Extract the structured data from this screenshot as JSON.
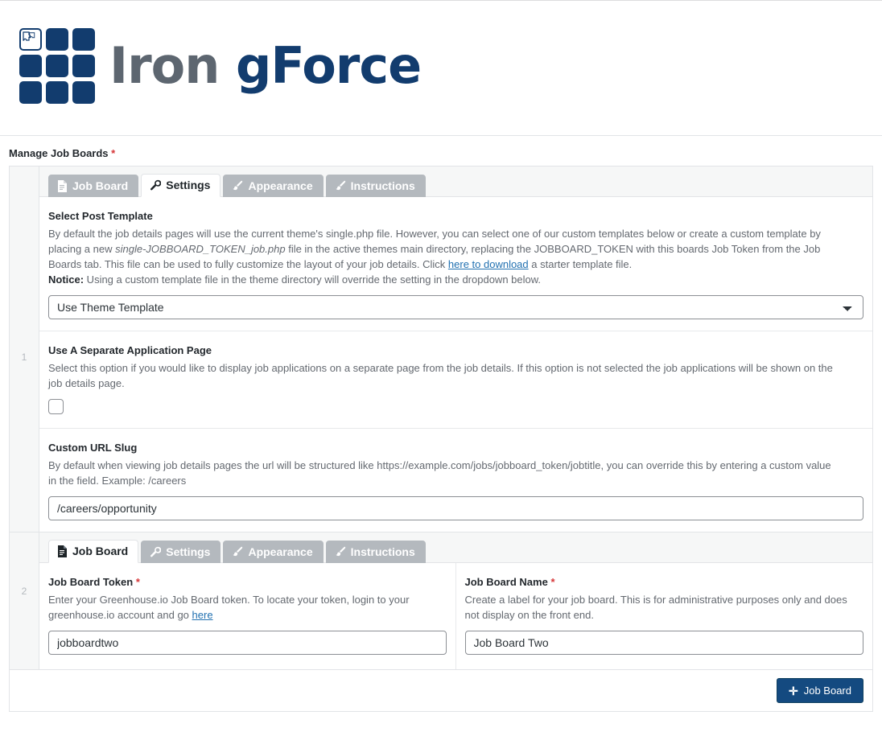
{
  "brand": {
    "name_part1": "Iron",
    "name_part2": "gForce",
    "logo_icon": "puzzle-grid-icon",
    "primary_color": "#123c6e",
    "secondary_color": "#5d6670"
  },
  "page": {
    "title": "Manage Job Boards",
    "required_marker": "*"
  },
  "board1": {
    "index": "1",
    "tabs": [
      {
        "label": "Job Board",
        "icon": "file-icon",
        "active": false
      },
      {
        "label": "Settings",
        "icon": "wrench-icon",
        "active": true
      },
      {
        "label": "Appearance",
        "icon": "paintbrush-icon",
        "active": false
      },
      {
        "label": "Instructions",
        "icon": "paintbrush-icon",
        "active": false
      }
    ],
    "post_template": {
      "label": "Select Post Template",
      "desc_part1": "By default the job details pages will use the current theme's single.php file. However, you can select one of our custom templates below or create a custom template by placing a new ",
      "desc_em": "single-JOBBOARD_TOKEN_job.php",
      "desc_part2": " file in the active themes main directory, replacing the JOBBOARD_TOKEN with this boards Job Token from the Job Boards tab. This file can be used to fully customize the layout of your job details. Click ",
      "desc_link": "here to download",
      "desc_part3": " a starter template file.",
      "notice_label": "Notice:",
      "notice_text": " Using a custom template file in the theme directory will override the setting in the dropdown below.",
      "selected": "Use Theme Template",
      "options": [
        "Use Theme Template"
      ]
    },
    "separate_page": {
      "label": "Use A Separate Application Page",
      "desc": "Select this option if you would like to display job applications on a separate page from the job details. If this option is not selected the job applications will be shown on the job details page.",
      "checked": false
    },
    "custom_slug": {
      "label": "Custom URL Slug",
      "desc": "By default when viewing job details pages the url will be structured like https://example.com/jobs/jobboard_token/jobtitle, you can override this by entering a custom value in the field. Example: /careers",
      "value": "/careers/opportunity",
      "placeholder": ""
    }
  },
  "board2": {
    "index": "2",
    "tabs": [
      {
        "label": "Job Board",
        "icon": "file-icon",
        "active": true
      },
      {
        "label": "Settings",
        "icon": "wrench-icon",
        "active": false
      },
      {
        "label": "Appearance",
        "icon": "paintbrush-icon",
        "active": false
      },
      {
        "label": "Instructions",
        "icon": "paintbrush-icon",
        "active": false
      }
    ],
    "token": {
      "label": "Job Board Token",
      "required_marker": "*",
      "desc_part1": "Enter your Greenhouse.io Job Board token. To locate your token, login to your greenhouse.io account and go ",
      "desc_link": "here",
      "value": "jobboardtwo"
    },
    "name": {
      "label": "Job Board Name",
      "required_marker": "*",
      "desc": "Create a label for your job board. This is for administrative purposes only and does not display on the front end.",
      "value": "Job Board Two"
    }
  },
  "footer": {
    "add_button_label": "Job Board",
    "add_button_icon": "plus-icon",
    "add_button_color": "#144a80"
  }
}
